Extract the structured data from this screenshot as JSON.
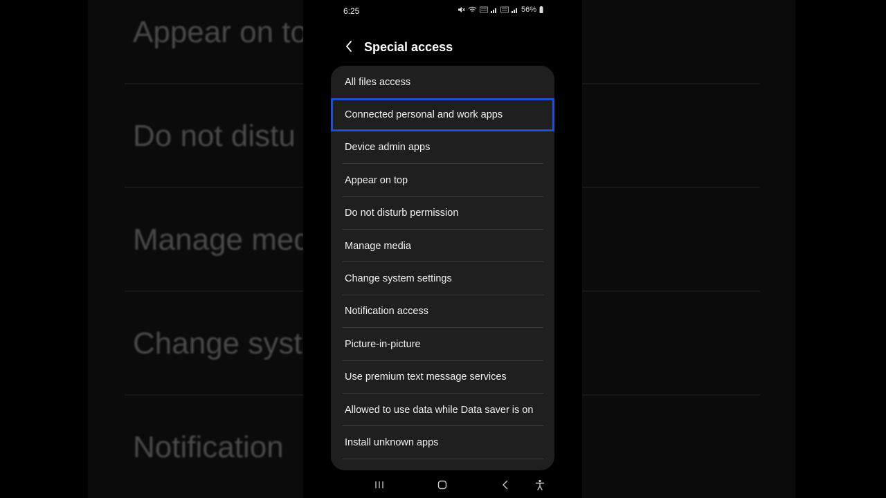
{
  "status_bar": {
    "time": "6:25",
    "battery": "56%",
    "icons": [
      "mute-icon",
      "wifi-icon",
      "volte-icon",
      "signal-icon",
      "battery-icon"
    ]
  },
  "header": {
    "title": "Special access"
  },
  "list": {
    "items": [
      {
        "label": "All files access"
      },
      {
        "label": "Connected personal and work apps"
      },
      {
        "label": "Device admin apps"
      },
      {
        "label": "Appear on top"
      },
      {
        "label": "Do not disturb permission"
      },
      {
        "label": "Manage media"
      },
      {
        "label": "Change system settings"
      },
      {
        "label": "Notification access"
      },
      {
        "label": "Picture-in-picture"
      },
      {
        "label": "Use premium text message services"
      },
      {
        "label": "Allowed to use data while Data saver is on"
      },
      {
        "label": "Install unknown apps"
      }
    ],
    "highlight_color": "#1f4fd6"
  },
  "background": {
    "items": [
      "Appear on to",
      "Do not distu",
      "Manage med",
      "Change syst",
      "Notification"
    ]
  },
  "nav_bar": {
    "icons": [
      "recents-icon",
      "home-icon",
      "back-icon",
      "accessibility-icon"
    ]
  }
}
